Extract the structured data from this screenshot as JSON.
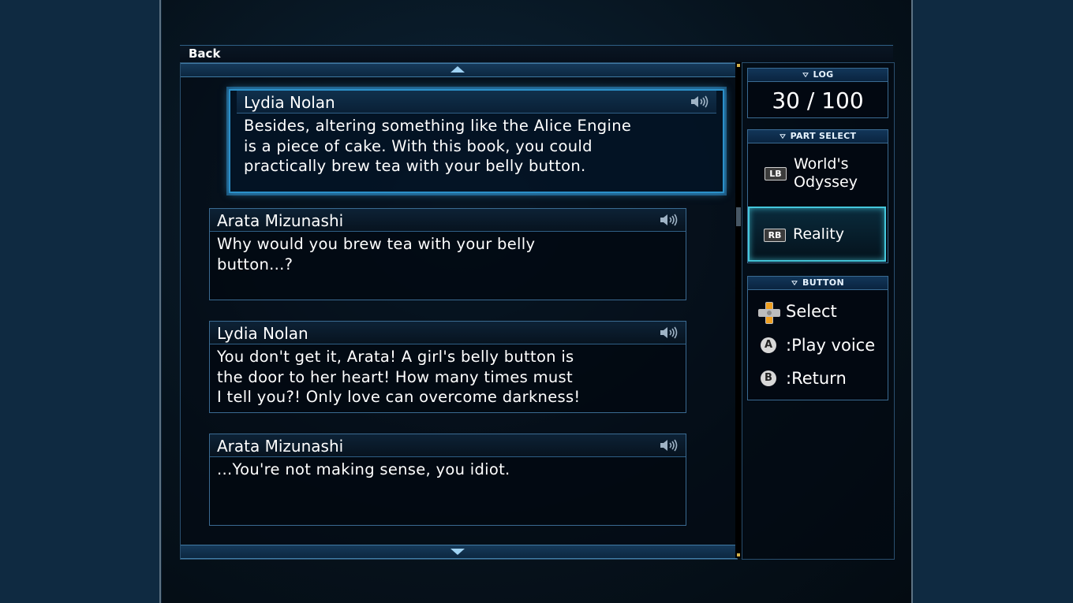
{
  "header": {
    "back_label": "Back"
  },
  "log": {
    "title": "LOG",
    "count": "30 / 100",
    "entries": [
      {
        "speaker": "Lydia Nolan",
        "text": "Besides, altering something like the Alice Engine\nis a piece of cake. With this book, you could\npractically brew tea with your belly button."
      },
      {
        "speaker": "Arata Mizunashi",
        "text": "Why would you brew tea with your belly\nbutton...?"
      },
      {
        "speaker": "Lydia Nolan",
        "text": "You don't get it, Arata! A girl's belly button is\nthe door to her heart! How many times must\nI tell you?! Only love can overcome darkness!"
      },
      {
        "speaker": "Arata Mizunashi",
        "text": "...You're not making sense, you idiot."
      }
    ]
  },
  "part_select": {
    "title": "PART SELECT",
    "items": [
      {
        "button": "LB",
        "label": "World's\nOdyssey"
      },
      {
        "button": "RB",
        "label": "Reality"
      }
    ]
  },
  "buttons": {
    "title": "BUTTON",
    "items": [
      {
        "icon": "dpad-icon",
        "label": "Select"
      },
      {
        "icon": "A",
        "label": ":Play voice"
      },
      {
        "icon": "B",
        "label": ":Return"
      }
    ]
  },
  "colors": {
    "accent": "#2b90c9",
    "active_part": "#45c7dc",
    "background": "#0c2236"
  }
}
